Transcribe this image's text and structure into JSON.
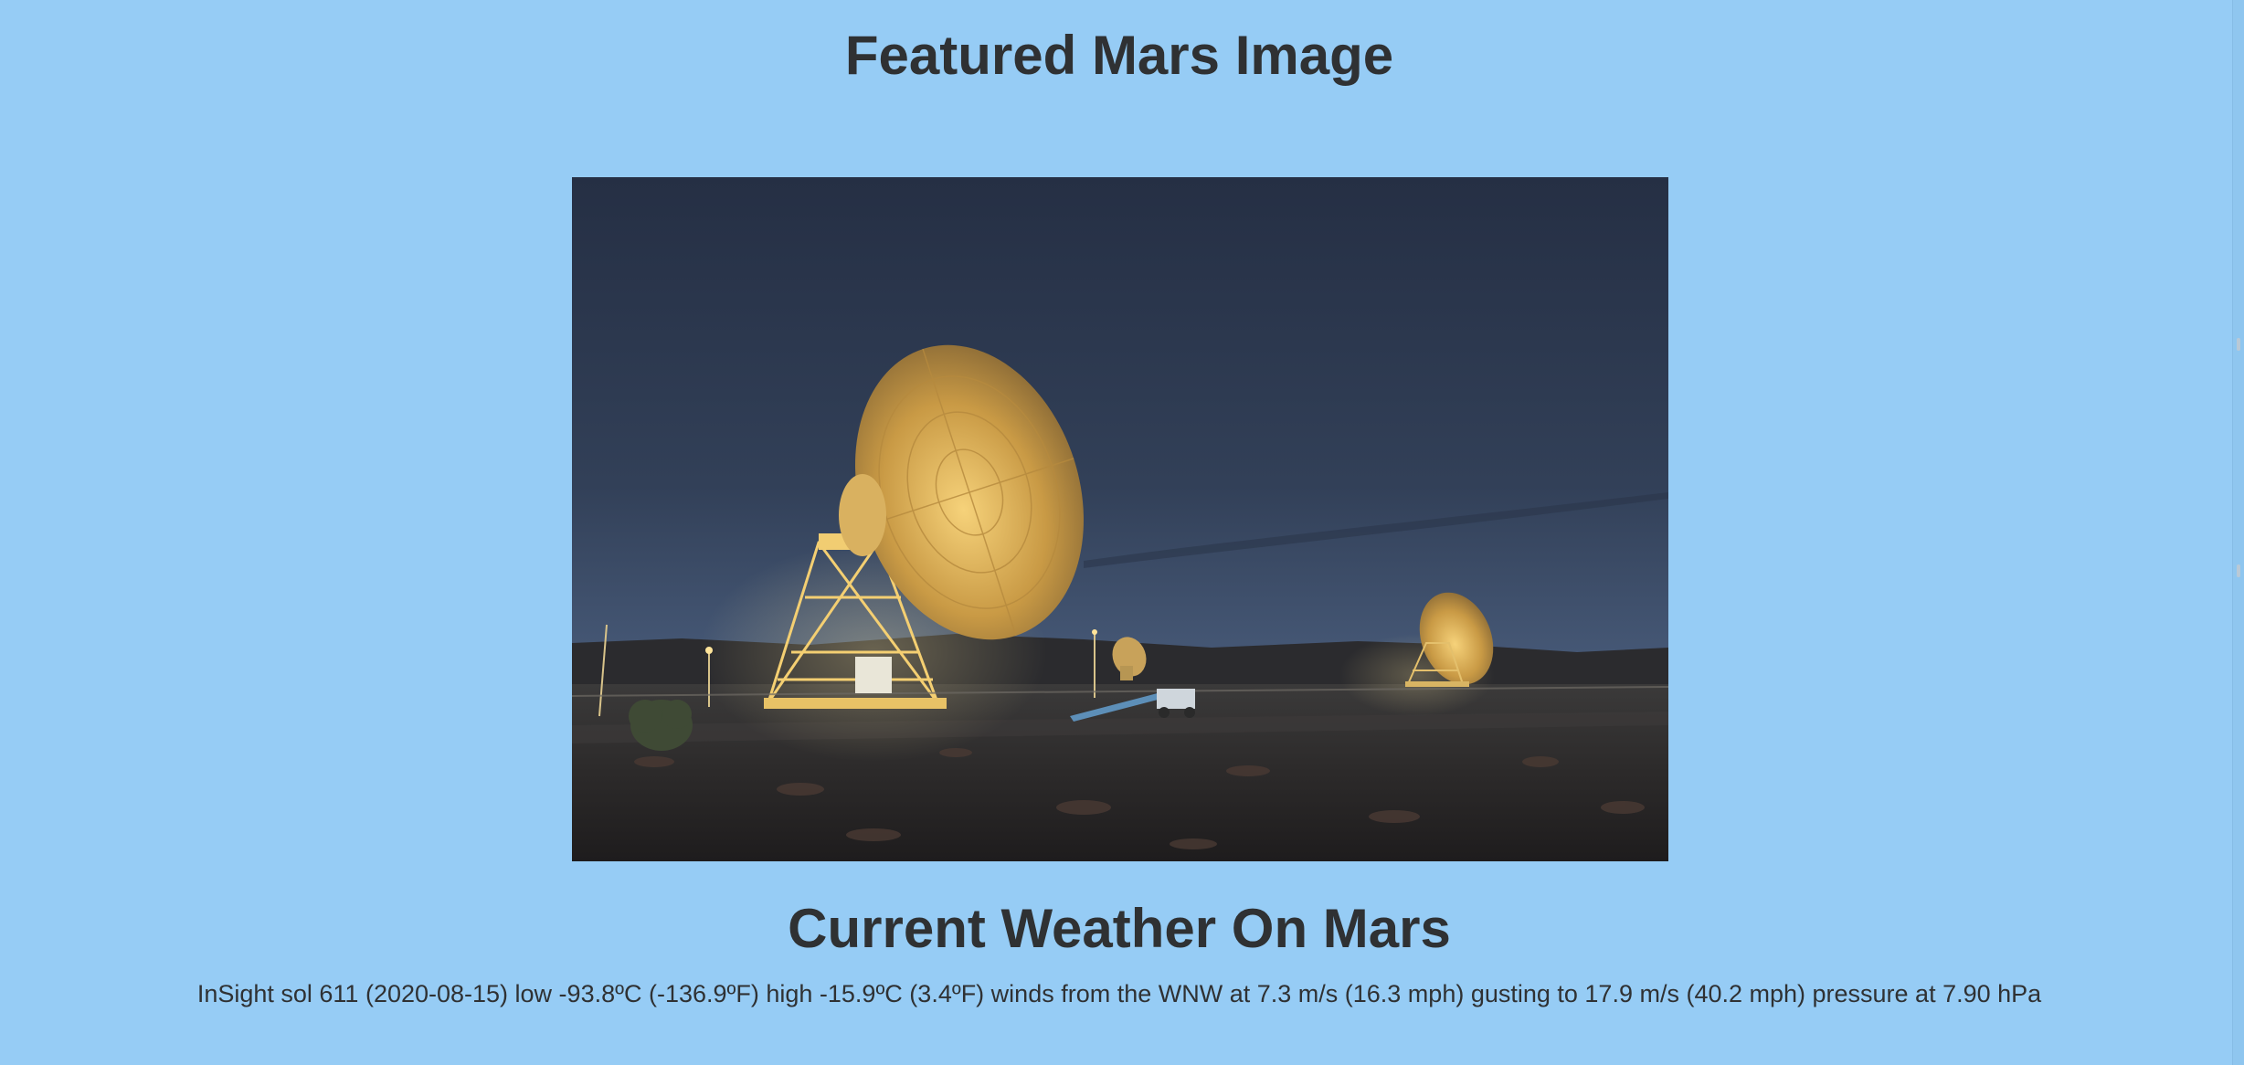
{
  "featured": {
    "heading": "Featured Mars Image",
    "image_alt": "Deep Space Network antennas at dusk"
  },
  "weather": {
    "heading": "Current Weather On Mars",
    "report": "InSight sol 611 (2020-08-15) low -93.8ºC (-136.9ºF) high -15.9ºC (3.4ºF) winds from the WNW at 7.3 m/s (16.3 mph) gusting to 17.9 m/s (40.2 mph) pressure at 7.90 hPa"
  },
  "colors": {
    "background": "#96ccf5",
    "text": "#2f3133"
  }
}
